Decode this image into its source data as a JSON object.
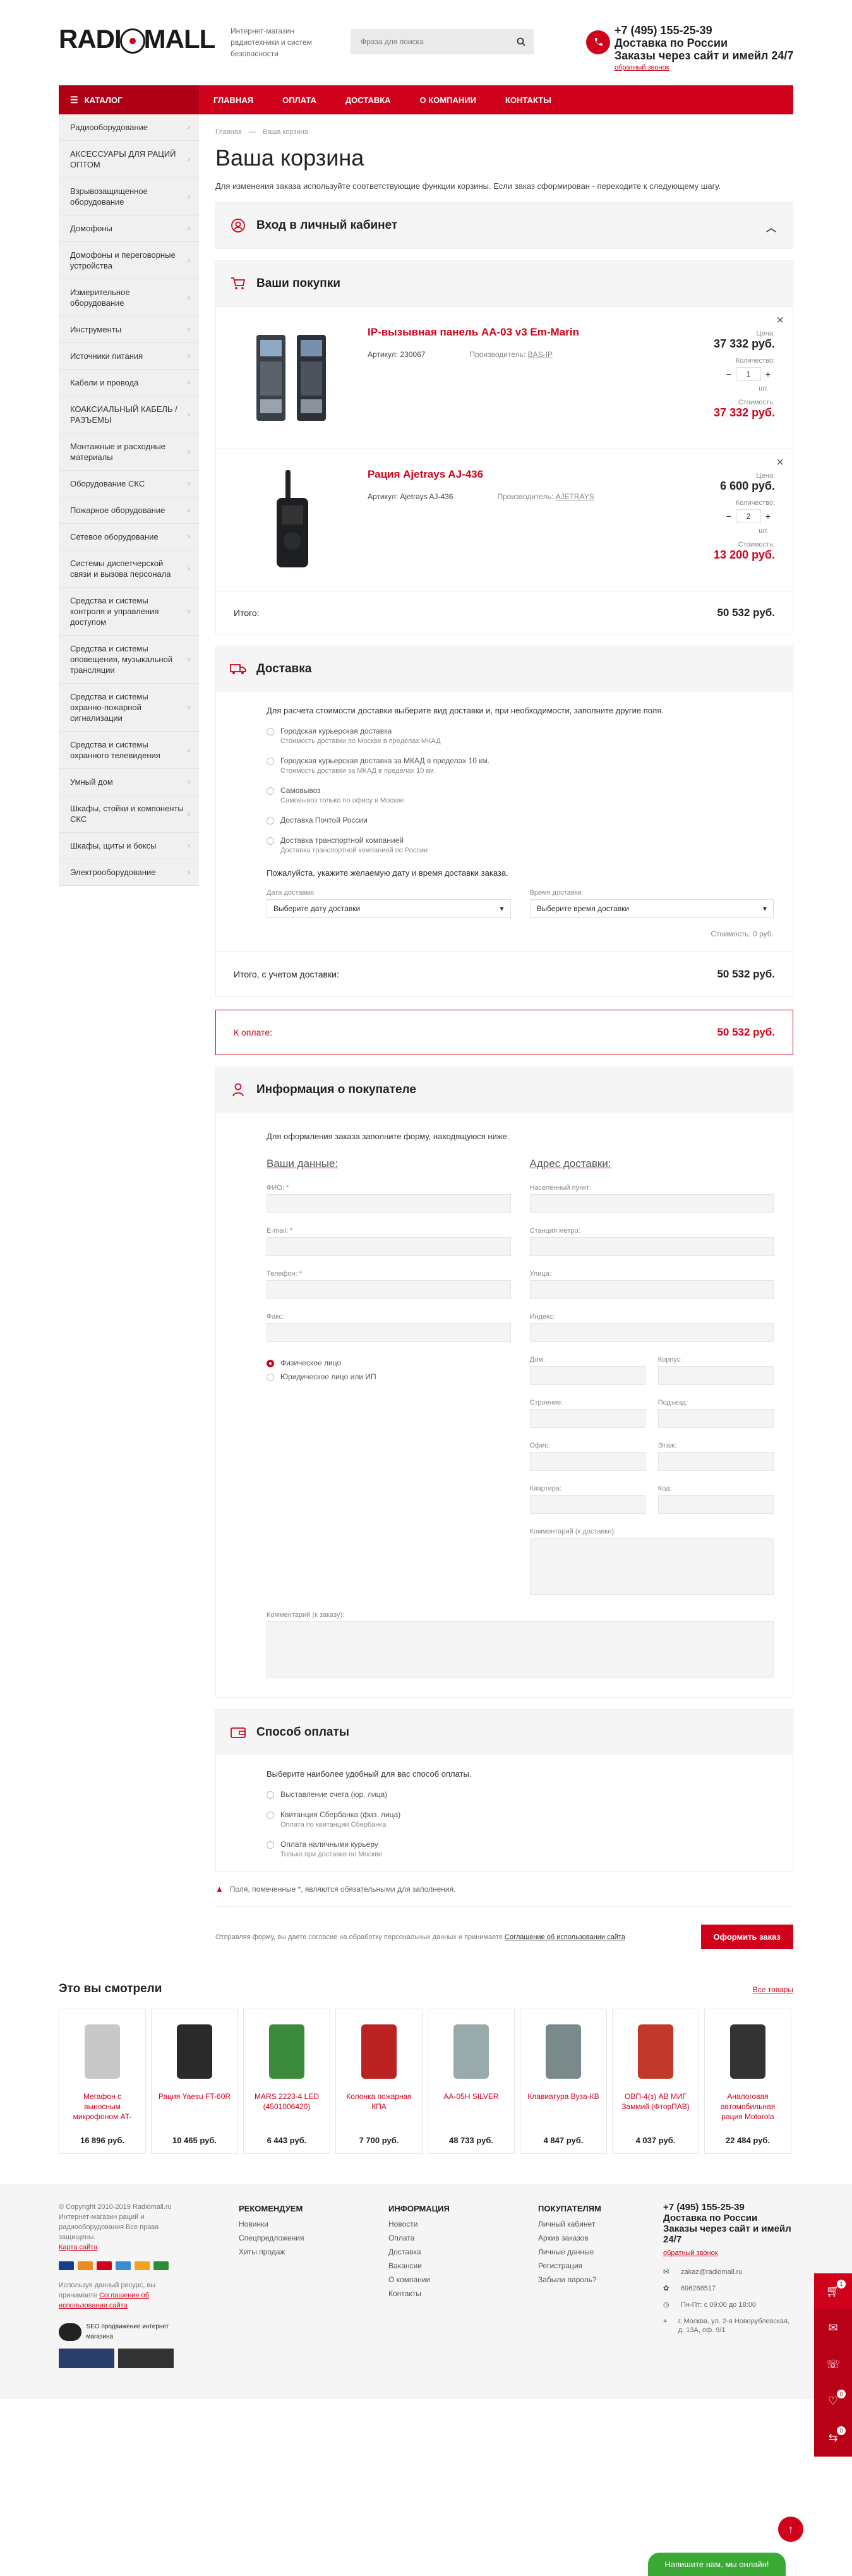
{
  "header": {
    "logo": "RADIOMALL",
    "tagline": "Интернет-магазин радиотехники и систем безопасности",
    "search_placeholder": "Фраза для поиска",
    "phone": "+7 (495) 155-25-39",
    "delivery": "Доставка по России",
    "orders": "Заказы через сайт и имейл 24/7",
    "callback": "обратный звонок"
  },
  "nav": {
    "catalog": "КАТАЛОГ",
    "items": [
      "ГЛАВНАЯ",
      "ОПЛАТА",
      "ДОСТАВКА",
      "О КОМПАНИИ",
      "КОНТАКТЫ"
    ]
  },
  "sidebar": [
    "Радиооборудование",
    "АКСЕССУАРЫ ДЛЯ РАЦИЙ ОПТОМ",
    "Взрывозащищенное оборудование",
    "Домофоны",
    "Домофоны и переговорные устройства",
    "Измерительное оборудование",
    "Инструменты",
    "Источники питания",
    "Кабели и провода",
    "КОАКСИАЛЬНЫЙ КАБЕЛЬ / РАЗЪЕМЫ",
    "Монтажные и расходные материалы",
    "Оборудование СКС",
    "Пожарное оборудование",
    "Сетевое оборудование",
    "Системы диспетчерской связи и вызова персонала",
    "Средства и системы контроля и управления доступом",
    "Средства и системы оповещения, музыкальной трансляции",
    "Средства и системы охранно-пожарной сигнализации",
    "Средства и системы охранного телевидения",
    "Умный дом",
    "Шкафы, стойки и компоненты СКС",
    "Шкафы, щиты и боксы",
    "Электрооборудование"
  ],
  "breadcrumb": [
    "Главная",
    "—",
    "Ваша корзина"
  ],
  "page": {
    "title": "Ваша корзина",
    "intro": "Для изменения заказа используйте соответствующие функции корзины. Если заказ сформирован - переходите к следующему шагу."
  },
  "login_panel": {
    "title": "Вход в личный кабинет"
  },
  "cart": {
    "title": "Ваши покупки",
    "labels": {
      "price": "Цена:",
      "qty": "Количество:",
      "unit": "шт.",
      "cost": "Стоимость:"
    },
    "items": [
      {
        "name": "IP-вызывная панель AA-03 v3 Em-Marin",
        "article": "Артикул: 230067",
        "mfr_label": "Производитель:",
        "mfr": "BAS-IP",
        "price": "37 332 руб.",
        "qty": "1",
        "total": "37 332 руб."
      },
      {
        "name": "Рация Ajetrays AJ-436",
        "article": "Артикул: Ajetrays AJ-436",
        "mfr_label": "Производитель:",
        "mfr": "AJETRAYS",
        "price": "6 600 руб.",
        "qty": "2",
        "total": "13 200 руб."
      }
    ],
    "total_label": "Итого:",
    "total": "50 532 руб."
  },
  "delivery": {
    "title": "Доставка",
    "hint": "Для расчета стоимости доставки выберите вид доставки и, при необходимости, заполните другие поля.",
    "options": [
      {
        "name": "Городская курьерская доставка",
        "sub": "Стоимость доставки по Москве в пределах МКАД"
      },
      {
        "name": "Городская курьерская доставка за МКАД в пределах 10 км.",
        "sub": "Стоимость доставки за МКАД в пределах 10 км."
      },
      {
        "name": "Самовывоз",
        "sub": "Самовывоз только по офису в Москве"
      },
      {
        "name": "Доставка Почтой России",
        "sub": ""
      },
      {
        "name": "Доставка транспортной компанией",
        "sub": "Доставка транспортной компанией по России"
      }
    ],
    "date_hint": "Пожалуйста, укажите желаемую дату и время доставки заказа.",
    "date_label": "Дата доставки:",
    "date_value": "Выберите дату доставки",
    "time_label": "Время доставки:",
    "time_value": "Выберите время доставки",
    "cost": "Стоимость: 0 руб."
  },
  "totals": {
    "with_delivery_label": "Итого, с учетом доставки:",
    "with_delivery": "50 532 руб.",
    "topay_label": "К оплате:",
    "topay": "50 532 руб."
  },
  "buyer": {
    "title": "Информация о покупателе",
    "hint": "Для оформления заказа заполните форму, находящуюся ниже.",
    "left_title": "Ваши данные:",
    "right_title": "Адрес доставки:",
    "left_fields": [
      "ФИО: *",
      "E-mail: *",
      "Телефон: *",
      "Факс:"
    ],
    "person_types": [
      "Физическое лицо",
      "Юридическое лицо или ИП"
    ],
    "right_fields": [
      "Населенный пункт:",
      "Станция метро:",
      "Улица:",
      "Индекс:"
    ],
    "pairs": [
      [
        "Дом:",
        "Корпус:"
      ],
      [
        "Строение:",
        "Подъезд:"
      ],
      [
        "Офис:",
        "Этаж:"
      ],
      [
        "Квартира:",
        "Код:"
      ]
    ],
    "addr_comment": "Комментарий (к доставке):",
    "order_comment": "Комментарий (к заказу):"
  },
  "payment": {
    "title": "Способ оплаты",
    "hint": "Выберите наиболее удобный для вас способ оплаты.",
    "options": [
      {
        "name": "Выставление счета (юр. лица)",
        "sub": ""
      },
      {
        "name": "Квитанция Сбербанка (физ. лица)",
        "sub": "Оплата по квитанции Сбербанка"
      },
      {
        "name": "Оплата наличными курьеру",
        "sub": "Только при доставке по Москве"
      }
    ]
  },
  "required_note": "Поля, помеченные *, являются обязательными для заполнения.",
  "consent": {
    "text": "Отправляя форму, вы даете согласие на обработку персональных данных и принимаете ",
    "link": "Соглашение об использовании сайта"
  },
  "submit": "Оформить заказ",
  "viewed": {
    "title": "Это вы смотрели",
    "all": "Все товары",
    "items": [
      {
        "name": "Мегафон с выносным микрофоном AT-",
        "price": "16 896 руб."
      },
      {
        "name": "Рация Yaesu FT-60R",
        "price": "10 465 руб."
      },
      {
        "name": "MARS 2223-4 LED (4501006420)",
        "price": "6 443 руб."
      },
      {
        "name": "Колонка пожарная КПА",
        "price": "7 700 руб."
      },
      {
        "name": "AA-05H SILVER",
        "price": "48 733 руб."
      },
      {
        "name": "Клавиатура Вуза-КВ",
        "price": "4 847 руб."
      },
      {
        "name": "ОВП-4(з) АВ МИГ Заммий (ФторПАВ)",
        "price": "4 037 руб."
      },
      {
        "name": "Аналоговая автомобильная рация Motorola",
        "price": "22 484 руб."
      }
    ]
  },
  "footer": {
    "copyright": "© Copyright 2010-2019 Radiomall.ru",
    "shop": "Интернет-магазин раций и радиооборудования Все права защищены.",
    "sitemap": "Карта сайта",
    "notice": "Используя данный ресурс, вы принимаете ",
    "notice_link": "Соглашение об использовании сайта",
    "seo": "SEO продвижение интернет магазина",
    "col1": {
      "title": "РЕКОМЕНДУЕМ",
      "links": [
        "Новинки",
        "Спецпредложения",
        "Хиты продаж"
      ]
    },
    "col2": {
      "title": "ИНФОРМАЦИЯ",
      "links": [
        "Новости",
        "Оплата",
        "Доставка",
        "Вакансии",
        "О компании",
        "Контакты"
      ]
    },
    "col3": {
      "title": "ПОКУПАТЕЛЯМ",
      "links": [
        "Личный кабинет",
        "Архив заказов",
        "Личные данные",
        "Регистрация",
        "Забыли пароль?"
      ]
    },
    "phone": "+7 (495) 155-25-39",
    "delivery": "Доставка по России",
    "orders": "Заказы через сайт и имейл 24/7",
    "callback": "обратный звонок",
    "email": "zakaz@radiomall.ru",
    "icq": "696268517",
    "hours": "Пн-Пт: с 09:00 до 18:00",
    "address": "г. Москва, ул. 2-я Новорублевская, д. 13А, оф. 9/1"
  },
  "floating": {
    "cart_count": "1",
    "fav_count": "0",
    "compare_count": "0"
  },
  "chat": "Напишите нам, мы онлайн!",
  "colors": {
    "brand": "#d0021b",
    "chat": "#3aaa35"
  }
}
